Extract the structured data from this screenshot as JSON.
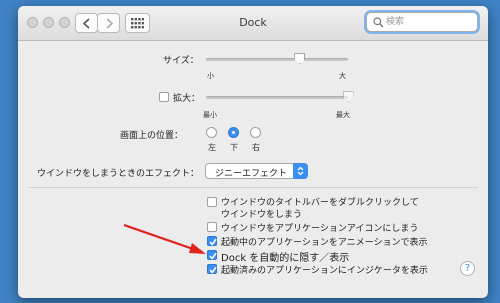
{
  "window": {
    "title": "Dock"
  },
  "search": {
    "placeholder": "検索"
  },
  "size": {
    "label": "サイズ：",
    "min_label": "小",
    "max_label": "大",
    "value_fraction": 0.66
  },
  "magnification": {
    "label": "拡大：",
    "checked": false,
    "min_label": "最小",
    "max_label": "最大",
    "value_fraction": 1.0
  },
  "position": {
    "label": "画面上の位置：",
    "options": [
      "左",
      "下",
      "右"
    ],
    "selected": "下"
  },
  "minimize": {
    "label": "ウインドウをしまうときのエフェクト：",
    "value": "ジニーエフェクト"
  },
  "options": [
    {
      "line1": "ウインドウのタイトルバーをダブルクリックして",
      "line2": "ウインドウをしまう",
      "checked": false
    },
    {
      "line1": "ウインドウをアプリケーションアイコンにしまう",
      "checked": false
    },
    {
      "line1": "起動中のアプリケーションをアニメーションで表示",
      "checked": true
    },
    {
      "line1": "Dock を自動的に隠す／表示",
      "checked": true
    },
    {
      "line1": "起動済みのアプリケーションにインジケータを表示",
      "checked": true
    }
  ],
  "help": {
    "label": "?"
  },
  "colors": {
    "accent": "#3b8ff0",
    "background": "#3f83c6",
    "annotation_arrow": "#e0231c"
  },
  "icons": [
    "grid-icon",
    "search-icon",
    "chevron-left-icon",
    "chevron-right-icon",
    "help-icon"
  ]
}
